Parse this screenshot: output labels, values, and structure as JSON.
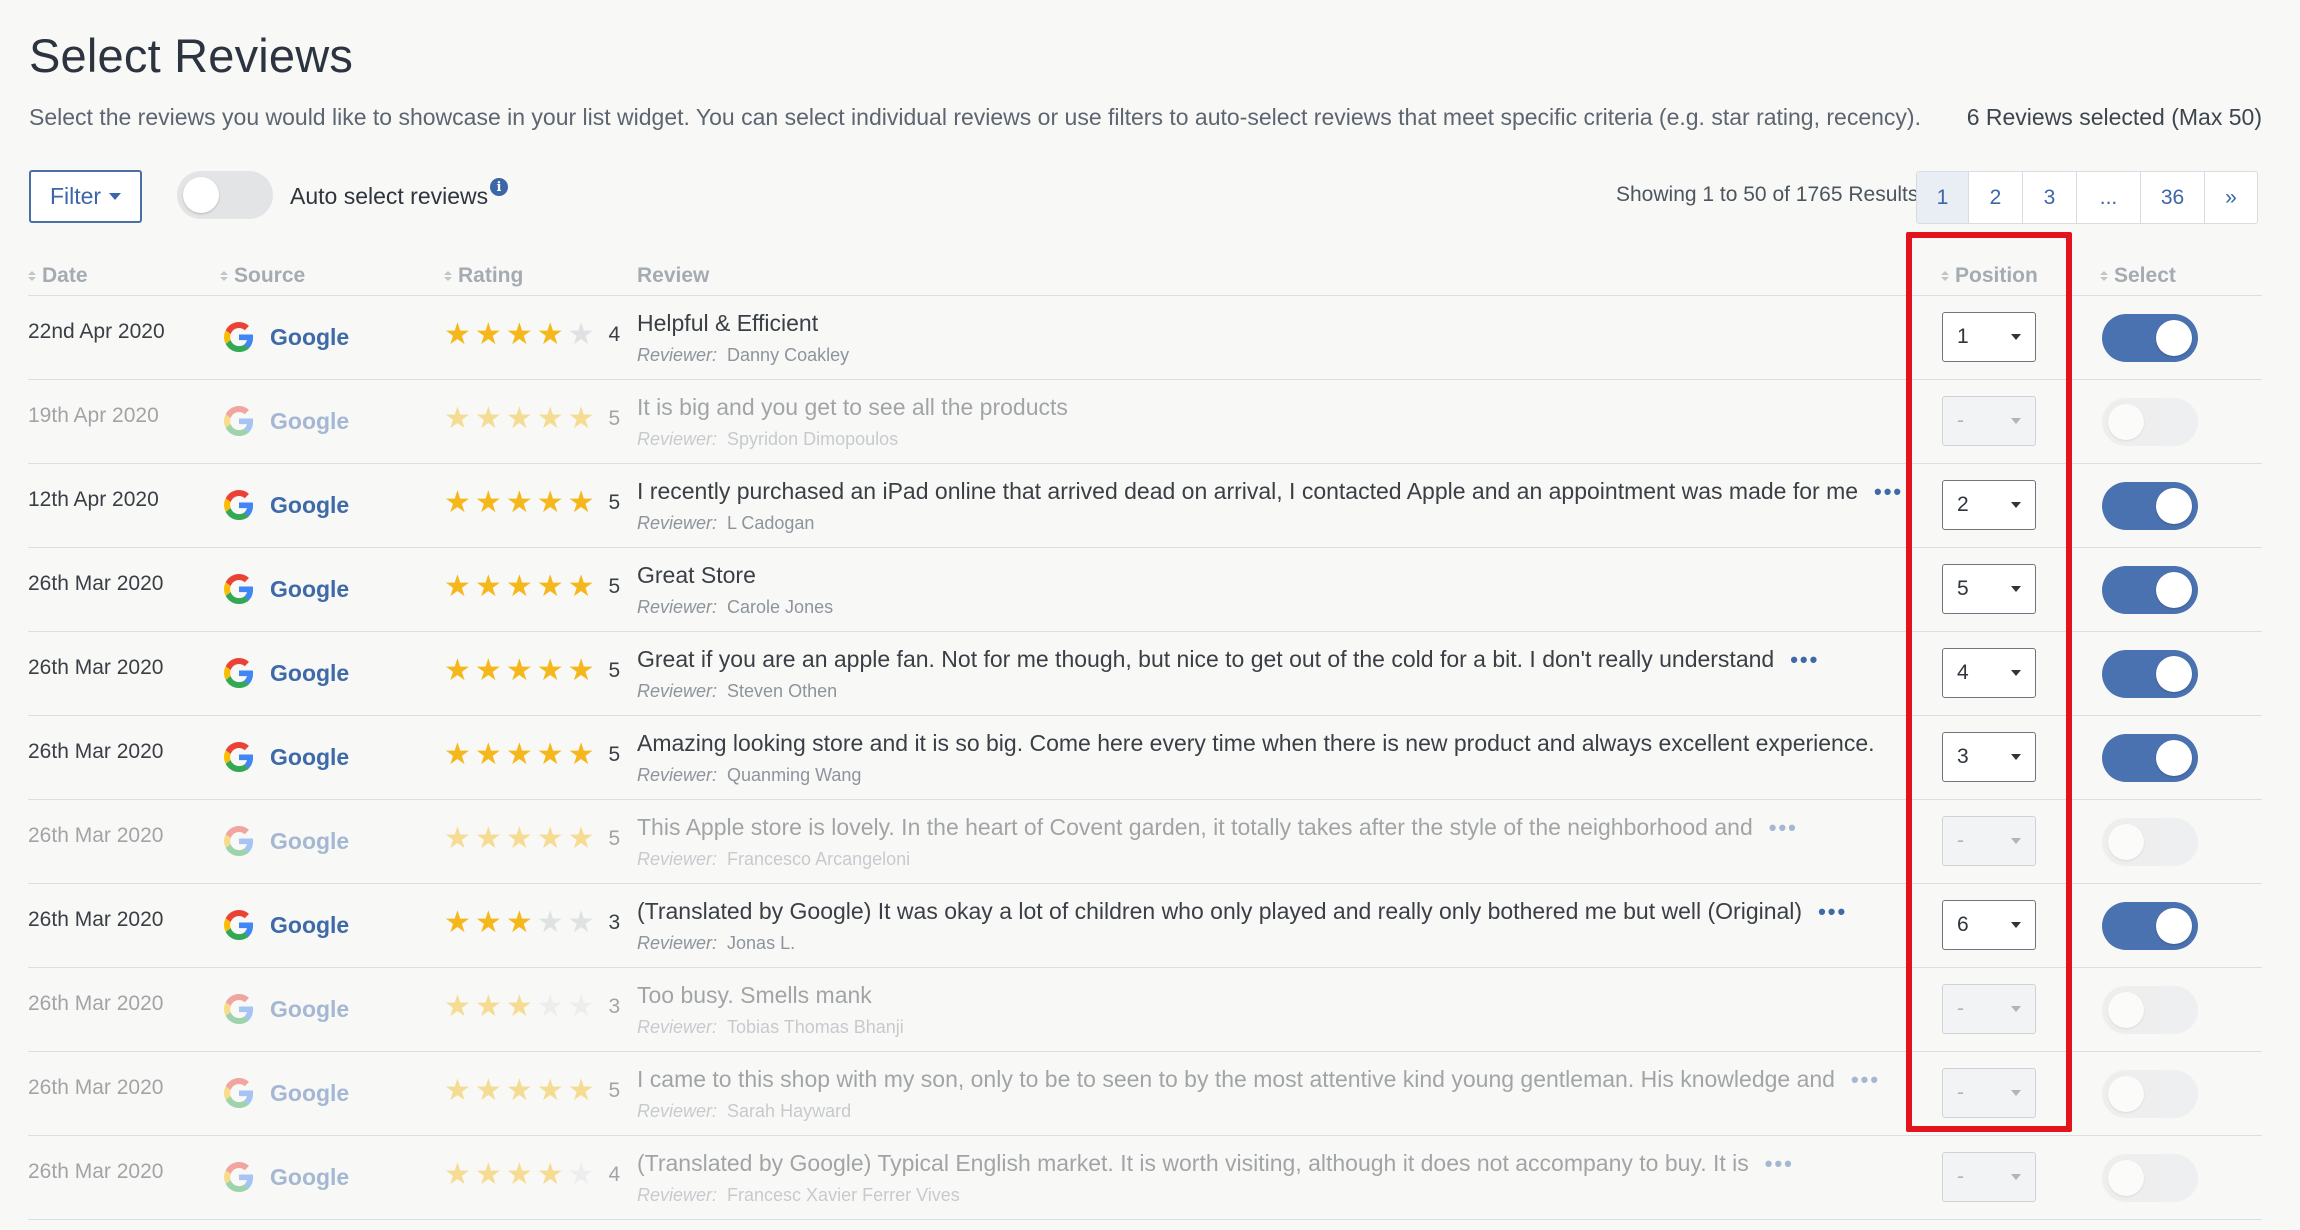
{
  "page": {
    "title": "Select Reviews",
    "subtitle": "Select the reviews you would like to showcase in your list widget. You can select individual reviews or use filters to auto-select reviews that meet specific criteria (e.g. star rating, recency).",
    "selected_count": "6 Reviews selected (Max 50)"
  },
  "toolbar": {
    "filter_label": "Filter",
    "auto_select_label": "Auto select reviews",
    "auto_select_on": false,
    "showing_text": "Showing 1 to 50 of 1765 Results",
    "pages": [
      "1",
      "2",
      "3",
      "...",
      "36",
      "»"
    ],
    "active_page": "1"
  },
  "columns": {
    "date": "Date",
    "source": "Source",
    "rating": "Rating",
    "review": "Review",
    "position": "Position",
    "select": "Select"
  },
  "reviewer_prefix": "Reviewer:",
  "rows": [
    {
      "date": "22nd Apr 2020",
      "source": "Google",
      "rating": 4,
      "rating_label": "4",
      "title": "Helpful & Efficient",
      "more": false,
      "reviewer": "Danny Coakley",
      "position": "1",
      "selected": true
    },
    {
      "date": "19th Apr 2020",
      "source": "Google",
      "rating": 5,
      "rating_label": "5",
      "title": "It is big and you get to see all the products",
      "more": false,
      "reviewer": "Spyridon Dimopoulos",
      "position": "-",
      "selected": false
    },
    {
      "date": "12th Apr 2020",
      "source": "Google",
      "rating": 5,
      "rating_label": "5",
      "title": "I recently purchased an iPad online that arrived dead on arrival, I contacted Apple and an appointment was made for me",
      "more": true,
      "reviewer": "L Cadogan",
      "position": "2",
      "selected": true
    },
    {
      "date": "26th Mar 2020",
      "source": "Google",
      "rating": 5,
      "rating_label": "5",
      "title": "Great Store",
      "more": false,
      "reviewer": "Carole Jones",
      "position": "5",
      "selected": true
    },
    {
      "date": "26th Mar 2020",
      "source": "Google",
      "rating": 5,
      "rating_label": "5",
      "title": "Great if you are an apple fan. Not for me though, but nice to get out of the cold for a bit. I don't really understand",
      "more": true,
      "reviewer": "Steven Othen",
      "position": "4",
      "selected": true
    },
    {
      "date": "26th Mar 2020",
      "source": "Google",
      "rating": 5,
      "rating_label": "5",
      "title": "Amazing looking store and it is so big. Come here every time when there is new product and always excellent experience.",
      "more": false,
      "reviewer": "Quanming Wang",
      "position": "3",
      "selected": true
    },
    {
      "date": "26th Mar 2020",
      "source": "Google",
      "rating": 5,
      "rating_label": "5",
      "title": "This Apple store is lovely. In the heart of Covent garden, it totally takes after the style of the neighborhood and",
      "more": true,
      "reviewer": "Francesco Arcangeloni",
      "position": "-",
      "selected": false
    },
    {
      "date": "26th Mar 2020",
      "source": "Google",
      "rating": 3,
      "rating_label": "3",
      "title": "(Translated by Google) It was okay a lot of children who only played and really only bothered me but well (Original)",
      "more": true,
      "reviewer": "Jonas L.",
      "position": "6",
      "selected": true
    },
    {
      "date": "26th Mar 2020",
      "source": "Google",
      "rating": 3,
      "rating_label": "3",
      "title": "Too busy. Smells mank",
      "more": false,
      "reviewer": "Tobias Thomas Bhanji",
      "position": "-",
      "selected": false
    },
    {
      "date": "26th Mar 2020",
      "source": "Google",
      "rating": 5,
      "rating_label": "5",
      "title": "I came to this shop with my son, only to be to seen to by the most attentive kind young gentleman. His knowledge and",
      "more": true,
      "reviewer": "Sarah Hayward",
      "position": "-",
      "selected": false
    },
    {
      "date": "26th Mar 2020",
      "source": "Google",
      "rating": 4,
      "rating_label": "4",
      "title": "(Translated by Google) Typical English market. It is worth visiting, although it does not accompany to buy. It is",
      "more": true,
      "reviewer": "Francesc Xavier Ferrer Vives",
      "position": "-",
      "selected": false
    }
  ],
  "colors": {
    "accent": "#3f6aa8",
    "toggle_on": "#4b72b0",
    "star": "#f5b81c",
    "highlight": "#e3141b"
  },
  "icons": {
    "source": "google-g-icon",
    "more": "ellipsis-icon",
    "info": "info-icon"
  }
}
